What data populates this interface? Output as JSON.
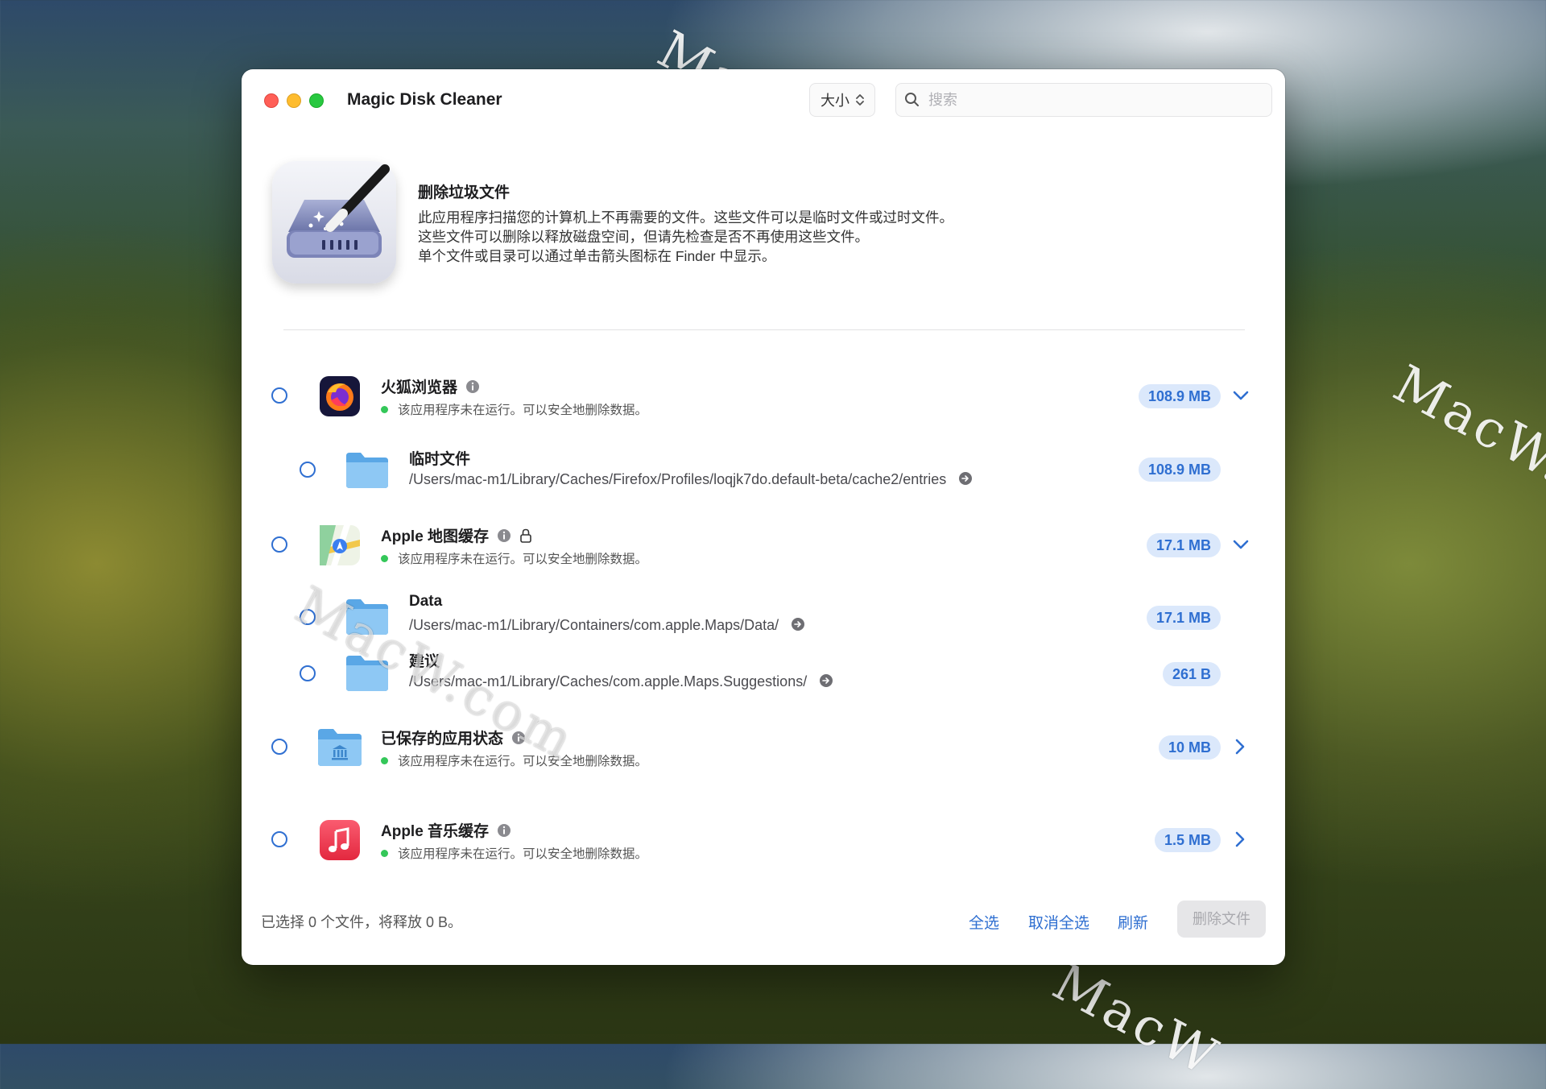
{
  "watermarks": [
    "MacW.com",
    "MacW.c",
    "MacW",
    "MacW.com"
  ],
  "window": {
    "title": "Magic Disk Cleaner",
    "sort_label": "大小",
    "search_placeholder": "搜索"
  },
  "intro": {
    "title": "删除垃圾文件",
    "lines": [
      "此应用程序扫描您的计算机上不再需要的文件。这些文件可以是临时文件或过时文件。",
      "这些文件可以删除以释放磁盘空间，但请先检查是否不再使用这些文件。",
      "单个文件或目录可以通过单击箭头图标在 Finder 中显示。"
    ]
  },
  "groups": [
    {
      "name": "火狐浏览器",
      "status": "该应用程序未在运行。可以安全地删除数据。",
      "size": "108.9 MB",
      "expanded": true,
      "locked": false,
      "children": [
        {
          "name": "临时文件",
          "path": "/Users/mac-m1/Library/Caches/Firefox/Profiles/loqjk7do.default-beta/cache2/entries",
          "size": "108.9 MB"
        }
      ]
    },
    {
      "name": "Apple 地图缓存",
      "status": "该应用程序未在运行。可以安全地删除数据。",
      "size": "17.1 MB",
      "expanded": true,
      "locked": true,
      "children": [
        {
          "name": "Data",
          "path": "/Users/mac-m1/Library/Containers/com.apple.Maps/Data/",
          "size": "17.1 MB"
        },
        {
          "name": "建议",
          "path": "/Users/mac-m1/Library/Caches/com.apple.Maps.Suggestions/",
          "size": "261 B"
        }
      ]
    },
    {
      "name": "已保存的应用状态",
      "status": "该应用程序未在运行。可以安全地删除数据。",
      "size": "10 MB",
      "expanded": false,
      "locked": false,
      "children": []
    },
    {
      "name": "Apple 音乐缓存",
      "status": "该应用程序未在运行。可以安全地删除数据。",
      "size": "1.5 MB",
      "expanded": false,
      "locked": false,
      "children": []
    }
  ],
  "footer": {
    "summary": "已选择 0 个文件，将释放 0 B。",
    "select_all": "全选",
    "deselect_all": "取消全选",
    "refresh": "刷新",
    "delete": "删除文件"
  },
  "colors": {
    "accent": "#2f6fd1",
    "badge_bg": "#dbe8fb",
    "status_green": "#34c759"
  }
}
